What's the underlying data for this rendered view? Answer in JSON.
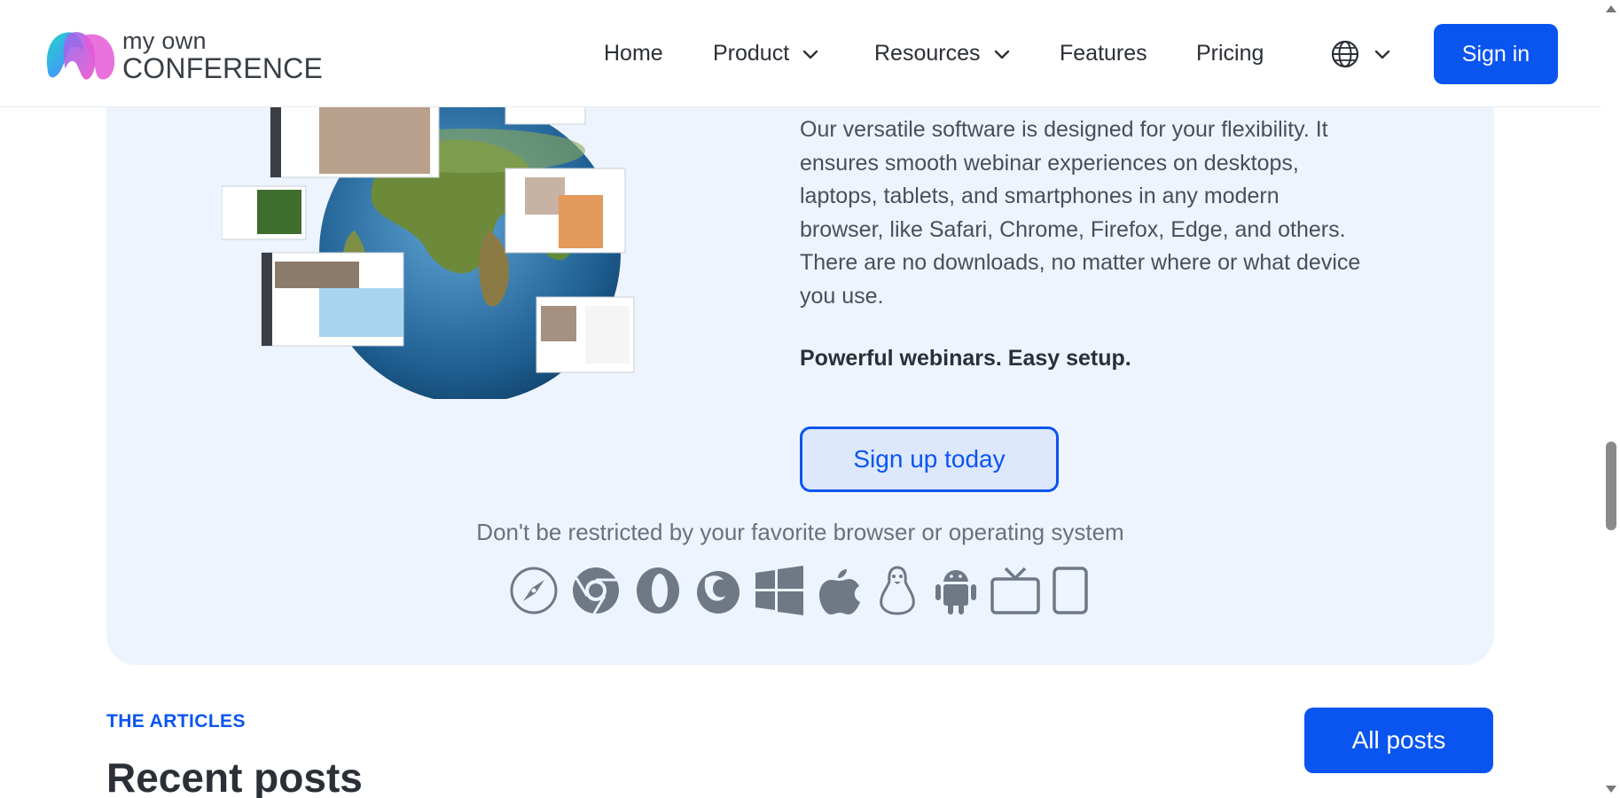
{
  "header": {
    "logo": {
      "line1": "my own",
      "line2": "CONFERENCE"
    },
    "nav": [
      {
        "label": "Home",
        "dropdown": false
      },
      {
        "label": "Product",
        "dropdown": true
      },
      {
        "label": "Resources",
        "dropdown": true
      },
      {
        "label": "Features",
        "dropdown": false
      },
      {
        "label": "Pricing",
        "dropdown": false
      }
    ],
    "language_icon": "globe-icon",
    "signin_label": "Sign in"
  },
  "hero": {
    "description": "Our versatile software is designed for your flexibility. It ensures smooth webinar experiences on desktops, laptops, tablets, and smartphones in any modern browser, like Safari, Chrome, Firefox, Edge, and others. There are no downloads, no matter where or what device you use.",
    "tagline": "Powerful webinars. Easy setup.",
    "signup_label": "Sign up today",
    "restriction_text": "Don't be restricted by your favorite browser or operating system",
    "platform_icons": [
      "safari-icon",
      "chrome-icon",
      "opera-icon",
      "firefox-icon",
      "windows-icon",
      "apple-icon",
      "linux-icon",
      "android-icon",
      "tv-icon",
      "tablet-icon"
    ]
  },
  "articles": {
    "eyebrow": "THE ARTICLES",
    "title": "Recent posts",
    "all_posts_label": "All posts"
  },
  "colors": {
    "accent": "#0a55f0",
    "panel_bg": "#eef4fe",
    "icon_gray": "#6f7986"
  }
}
